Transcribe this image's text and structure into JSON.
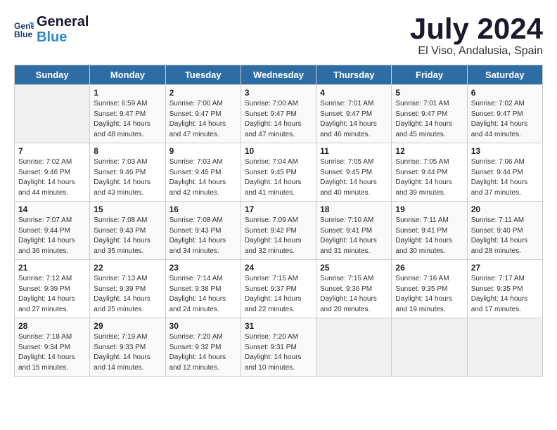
{
  "header": {
    "logo_line1": "General",
    "logo_line2": "Blue",
    "month_year": "July 2024",
    "location": "El Viso, Andalusia, Spain"
  },
  "weekdays": [
    "Sunday",
    "Monday",
    "Tuesday",
    "Wednesday",
    "Thursday",
    "Friday",
    "Saturday"
  ],
  "weeks": [
    [
      {
        "day": "",
        "sunrise": "",
        "sunset": "",
        "daylight": ""
      },
      {
        "day": "1",
        "sunrise": "Sunrise: 6:59 AM",
        "sunset": "Sunset: 9:47 PM",
        "daylight": "Daylight: 14 hours and 48 minutes."
      },
      {
        "day": "2",
        "sunrise": "Sunrise: 7:00 AM",
        "sunset": "Sunset: 9:47 PM",
        "daylight": "Daylight: 14 hours and 47 minutes."
      },
      {
        "day": "3",
        "sunrise": "Sunrise: 7:00 AM",
        "sunset": "Sunset: 9:47 PM",
        "daylight": "Daylight: 14 hours and 47 minutes."
      },
      {
        "day": "4",
        "sunrise": "Sunrise: 7:01 AM",
        "sunset": "Sunset: 9:47 PM",
        "daylight": "Daylight: 14 hours and 46 minutes."
      },
      {
        "day": "5",
        "sunrise": "Sunrise: 7:01 AM",
        "sunset": "Sunset: 9:47 PM",
        "daylight": "Daylight: 14 hours and 45 minutes."
      },
      {
        "day": "6",
        "sunrise": "Sunrise: 7:02 AM",
        "sunset": "Sunset: 9:47 PM",
        "daylight": "Daylight: 14 hours and 44 minutes."
      }
    ],
    [
      {
        "day": "7",
        "sunrise": "Sunrise: 7:02 AM",
        "sunset": "Sunset: 9:46 PM",
        "daylight": "Daylight: 14 hours and 44 minutes."
      },
      {
        "day": "8",
        "sunrise": "Sunrise: 7:03 AM",
        "sunset": "Sunset: 9:46 PM",
        "daylight": "Daylight: 14 hours and 43 minutes."
      },
      {
        "day": "9",
        "sunrise": "Sunrise: 7:03 AM",
        "sunset": "Sunset: 9:46 PM",
        "daylight": "Daylight: 14 hours and 42 minutes."
      },
      {
        "day": "10",
        "sunrise": "Sunrise: 7:04 AM",
        "sunset": "Sunset: 9:45 PM",
        "daylight": "Daylight: 14 hours and 41 minutes."
      },
      {
        "day": "11",
        "sunrise": "Sunrise: 7:05 AM",
        "sunset": "Sunset: 9:45 PM",
        "daylight": "Daylight: 14 hours and 40 minutes."
      },
      {
        "day": "12",
        "sunrise": "Sunrise: 7:05 AM",
        "sunset": "Sunset: 9:44 PM",
        "daylight": "Daylight: 14 hours and 39 minutes."
      },
      {
        "day": "13",
        "sunrise": "Sunrise: 7:06 AM",
        "sunset": "Sunset: 9:44 PM",
        "daylight": "Daylight: 14 hours and 37 minutes."
      }
    ],
    [
      {
        "day": "14",
        "sunrise": "Sunrise: 7:07 AM",
        "sunset": "Sunset: 9:44 PM",
        "daylight": "Daylight: 14 hours and 36 minutes."
      },
      {
        "day": "15",
        "sunrise": "Sunrise: 7:08 AM",
        "sunset": "Sunset: 9:43 PM",
        "daylight": "Daylight: 14 hours and 35 minutes."
      },
      {
        "day": "16",
        "sunrise": "Sunrise: 7:08 AM",
        "sunset": "Sunset: 9:43 PM",
        "daylight": "Daylight: 14 hours and 34 minutes."
      },
      {
        "day": "17",
        "sunrise": "Sunrise: 7:09 AM",
        "sunset": "Sunset: 9:42 PM",
        "daylight": "Daylight: 14 hours and 32 minutes."
      },
      {
        "day": "18",
        "sunrise": "Sunrise: 7:10 AM",
        "sunset": "Sunset: 9:41 PM",
        "daylight": "Daylight: 14 hours and 31 minutes."
      },
      {
        "day": "19",
        "sunrise": "Sunrise: 7:11 AM",
        "sunset": "Sunset: 9:41 PM",
        "daylight": "Daylight: 14 hours and 30 minutes."
      },
      {
        "day": "20",
        "sunrise": "Sunrise: 7:11 AM",
        "sunset": "Sunset: 9:40 PM",
        "daylight": "Daylight: 14 hours and 28 minutes."
      }
    ],
    [
      {
        "day": "21",
        "sunrise": "Sunrise: 7:12 AM",
        "sunset": "Sunset: 9:39 PM",
        "daylight": "Daylight: 14 hours and 27 minutes."
      },
      {
        "day": "22",
        "sunrise": "Sunrise: 7:13 AM",
        "sunset": "Sunset: 9:39 PM",
        "daylight": "Daylight: 14 hours and 25 minutes."
      },
      {
        "day": "23",
        "sunrise": "Sunrise: 7:14 AM",
        "sunset": "Sunset: 9:38 PM",
        "daylight": "Daylight: 14 hours and 24 minutes."
      },
      {
        "day": "24",
        "sunrise": "Sunrise: 7:15 AM",
        "sunset": "Sunset: 9:37 PM",
        "daylight": "Daylight: 14 hours and 22 minutes."
      },
      {
        "day": "25",
        "sunrise": "Sunrise: 7:15 AM",
        "sunset": "Sunset: 9:36 PM",
        "daylight": "Daylight: 14 hours and 20 minutes."
      },
      {
        "day": "26",
        "sunrise": "Sunrise: 7:16 AM",
        "sunset": "Sunset: 9:35 PM",
        "daylight": "Daylight: 14 hours and 19 minutes."
      },
      {
        "day": "27",
        "sunrise": "Sunrise: 7:17 AM",
        "sunset": "Sunset: 9:35 PM",
        "daylight": "Daylight: 14 hours and 17 minutes."
      }
    ],
    [
      {
        "day": "28",
        "sunrise": "Sunrise: 7:18 AM",
        "sunset": "Sunset: 9:34 PM",
        "daylight": "Daylight: 14 hours and 15 minutes."
      },
      {
        "day": "29",
        "sunrise": "Sunrise: 7:19 AM",
        "sunset": "Sunset: 9:33 PM",
        "daylight": "Daylight: 14 hours and 14 minutes."
      },
      {
        "day": "30",
        "sunrise": "Sunrise: 7:20 AM",
        "sunset": "Sunset: 9:32 PM",
        "daylight": "Daylight: 14 hours and 12 minutes."
      },
      {
        "day": "31",
        "sunrise": "Sunrise: 7:20 AM",
        "sunset": "Sunset: 9:31 PM",
        "daylight": "Daylight: 14 hours and 10 minutes."
      },
      {
        "day": "",
        "sunrise": "",
        "sunset": "",
        "daylight": ""
      },
      {
        "day": "",
        "sunrise": "",
        "sunset": "",
        "daylight": ""
      },
      {
        "day": "",
        "sunrise": "",
        "sunset": "",
        "daylight": ""
      }
    ]
  ]
}
